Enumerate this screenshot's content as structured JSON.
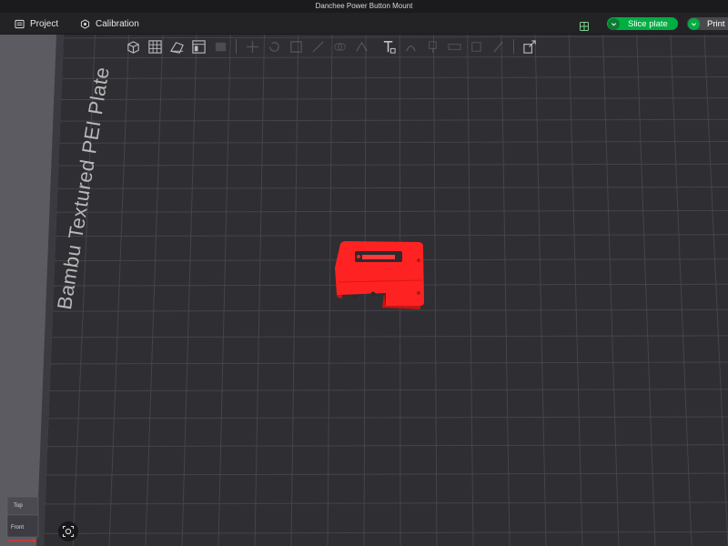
{
  "window": {
    "title": "Danchee Power Button Mount"
  },
  "menubar": {
    "project_label": "Project",
    "calibration_label": "Calibration",
    "slice_label": "Slice plate",
    "print_label": "Print"
  },
  "plate": {
    "label": "Bambu Textured PEI Plate"
  },
  "navcube": {
    "top_label": "Top",
    "front_label": "Front"
  },
  "colors": {
    "accent": "#00ae42",
    "model": "#ff2222",
    "grid": "#44444a",
    "bed": "#2e2e33"
  },
  "toolbar": {
    "icons": [
      "add-cube-icon",
      "arrange-grid-icon",
      "orient-icon",
      "plate-list-icon",
      "layers-icon",
      "move-icon",
      "rotate-icon",
      "scale-icon",
      "cut-icon",
      "mesh-boolean-icon",
      "support-paint-icon",
      "text-tool-icon",
      "seam-icon",
      "color-paint-icon",
      "measure-icon",
      "emboss-icon",
      "slash-icon",
      "assemble-icon"
    ]
  }
}
